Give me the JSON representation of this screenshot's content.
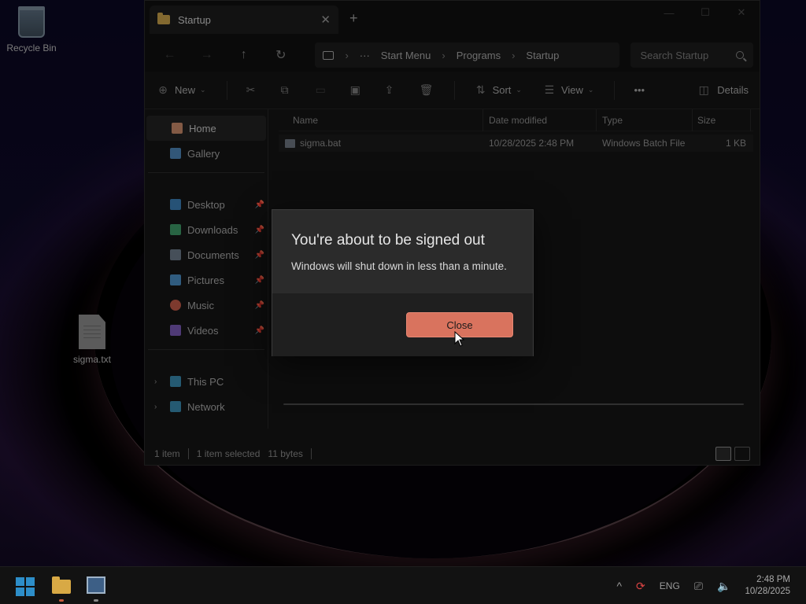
{
  "desktop": {
    "recycle_bin_label": "Recycle Bin",
    "file_label": "sigma.txt"
  },
  "explorer": {
    "tab_title": "Startup",
    "tab_close": "✕",
    "new_tab": "+",
    "window_controls": {
      "minimize": "—",
      "maximize": "☐",
      "close": "✕"
    },
    "nav": {
      "back": "←",
      "forward": "→",
      "up": "↑",
      "refresh": "↻"
    },
    "address": {
      "overflow": "···",
      "separator": "›",
      "crumbs": [
        "Start Menu",
        "Programs",
        "Startup"
      ]
    },
    "search_placeholder": "Search Startup",
    "toolbar": {
      "new_label": "New",
      "sort_label": "Sort",
      "view_label": "View",
      "more_label": "•••",
      "details_label": "Details",
      "caret": "⌄"
    },
    "sidebar": {
      "home": "Home",
      "gallery": "Gallery",
      "desktop": "Desktop",
      "downloads": "Downloads",
      "documents": "Documents",
      "pictures": "Pictures",
      "music": "Music",
      "videos": "Videos",
      "this_pc": "This PC",
      "network": "Network",
      "pin": "📌",
      "chevron": "›"
    },
    "columns": {
      "name": "Name",
      "date": "Date modified",
      "type": "Type",
      "size": "Size"
    },
    "files": [
      {
        "name": "sigma.bat",
        "date": "10/28/2025 2:48 PM",
        "type": "Windows Batch File",
        "size": "1 KB"
      }
    ],
    "status": {
      "items": "1 item",
      "selected": "1 item selected",
      "bytes": "11 bytes"
    }
  },
  "dialog": {
    "title": "You're about to be signed out",
    "message": "Windows will shut down in less than a minute.",
    "close_label": "Close"
  },
  "taskbar": {
    "tray_chevron": "^",
    "language": "ENG",
    "time": "2:48 PM",
    "date": "10/28/2025"
  },
  "colors": {
    "accent_button": "#d9735e",
    "start_blue": "#2d8ec9",
    "folder_yellow": "#d8a945"
  }
}
